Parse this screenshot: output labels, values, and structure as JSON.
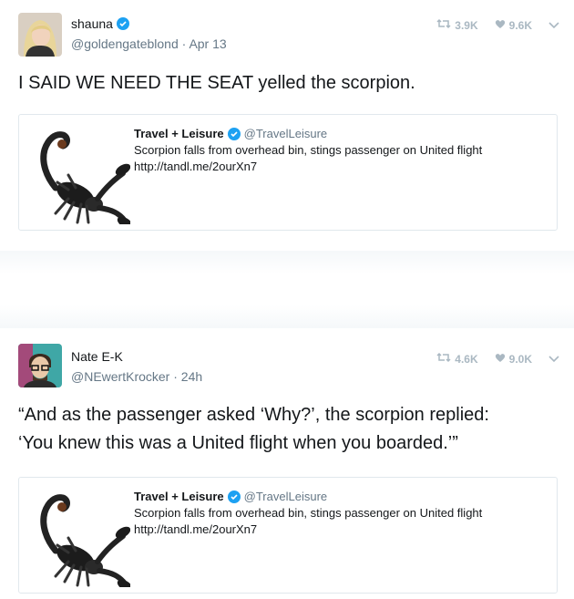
{
  "tweets": [
    {
      "author": {
        "name": "shauna",
        "handle": "@goldengateblond",
        "time": "Apr 13"
      },
      "retweets": "3.9K",
      "likes": "9.6K",
      "text": "I SAID WE NEED THE SEAT yelled the scorpion.",
      "quoted": {
        "name": "Travel + Leisure",
        "handle": "@TravelLeisure",
        "text": "Scorpion falls from overhead bin, stings passenger on United flight",
        "link": "http://tandl.me/2ourXn7"
      }
    },
    {
      "author": {
        "name": "Nate E-K",
        "handle": "@NEwertKrocker",
        "time": "24h"
      },
      "retweets": "4.6K",
      "likes": "9.0K",
      "text_line1": "“And as the passenger asked ‘Why?’, the scorpion replied:",
      "text_line2": "‘You knew this was a United flight when you boarded.’”",
      "quoted": {
        "name": "Travel + Leisure",
        "handle": "@TravelLeisure",
        "text": "Scorpion falls from overhead bin, stings passenger on United flight",
        "link": "http://tandl.me/2ourXn7"
      }
    }
  ],
  "colors": {
    "verified": "#1da1f2",
    "secondary": "#657786",
    "stat": "#aab8c2",
    "border": "#e1e8ed"
  },
  "icons": {
    "retweet": "retweet-icon",
    "like": "heart-icon",
    "menu": "chevron-down-icon",
    "verified": "verified-badge-icon"
  }
}
